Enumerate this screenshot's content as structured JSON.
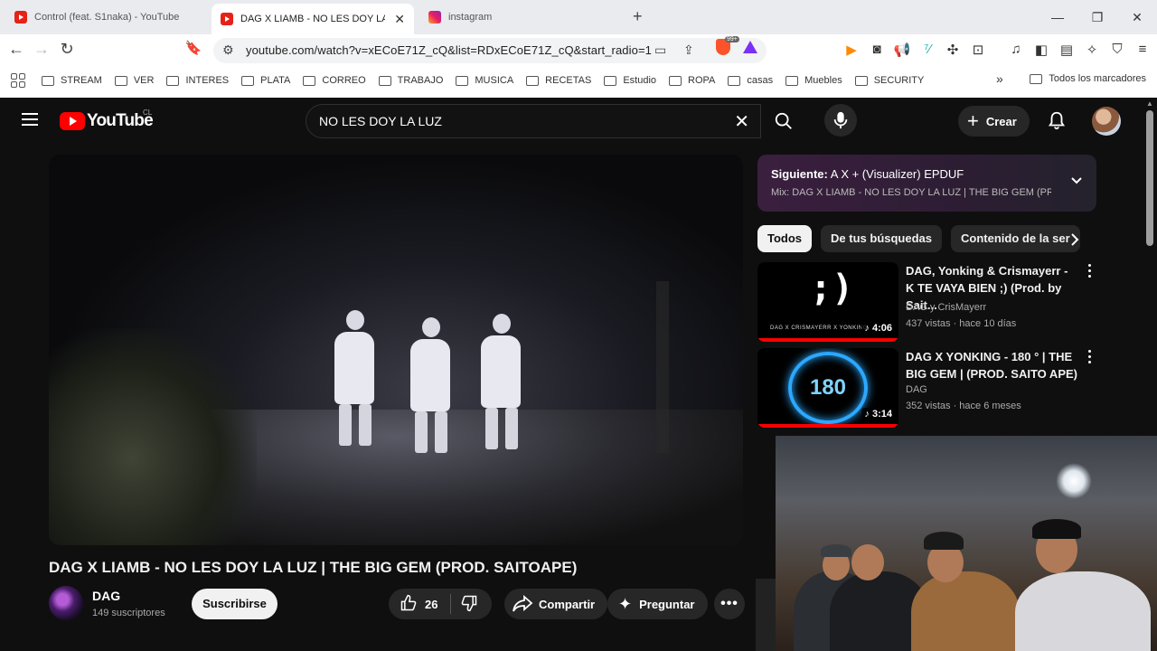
{
  "browser": {
    "tabs": [
      {
        "title": "Control (feat. S1naka) - YouTube",
        "icon": "youtube-icon"
      },
      {
        "title": "DAG X LIAMB - NO LES DOY LA LUZ",
        "icon": "youtube-icon",
        "active": true
      },
      {
        "title": "instagram",
        "icon": "instagram-icon"
      }
    ],
    "url": "youtube.com/watch?v=xECoE71Z_cQ&list=RDxECoE71Z_cQ&start_radio=1",
    "brave_badge": "99+",
    "bookmarks": [
      "STREAM",
      "VER",
      "INTERES",
      "PLATA",
      "CORREO",
      "TRABAJO",
      "MUSICA",
      "RECETAS",
      "Estudio",
      "ROPA",
      "casas",
      "Muebles",
      "SECURITY"
    ],
    "all_bookmarks": "Todos los marcadores"
  },
  "youtube": {
    "logo": "YouTube",
    "country": "CL",
    "search_query": "NO LES DOY LA LUZ",
    "create_label": "Crear"
  },
  "video": {
    "title": "DAG X LIAMB - NO LES DOY LA LUZ | THE BIG GEM (PROD. SAITOAPE)",
    "channel": "DAG",
    "subscribers": "149 suscriptores",
    "subscribe_label": "Suscribirse",
    "likes": "26",
    "share_label": "Compartir",
    "ask_label": "Preguntar"
  },
  "up_next": {
    "label": "Siguiente:",
    "title": "A X + (Visualizer) EPDUF",
    "mix": "Mix: DAG X LIAMB - NO LES DOY LA LUZ | THE BIG GEM (PR..."
  },
  "chips": [
    "Todos",
    "De tus búsquedas",
    "Contenido de la ser"
  ],
  "recommendations": [
    {
      "title": "DAG, Yonking & Crismayerr - K TE VAYA BIEN ;) (Prod. by Sait...",
      "channel": "DAG y CrisMayerr",
      "meta": "437 vistas · hace 10 días",
      "duration": "4:06",
      "thumb_text": ";)",
      "thumb_caption": "DAG X CRISMAYERR X YONKING"
    },
    {
      "title": "DAG X YONKING - 180 ° | THE BIG GEM | (PROD. SAITO APE)",
      "channel": "DAG",
      "meta": "352 vistas · hace 6 meses",
      "duration": "3:14",
      "thumb_text": "180"
    }
  ]
}
